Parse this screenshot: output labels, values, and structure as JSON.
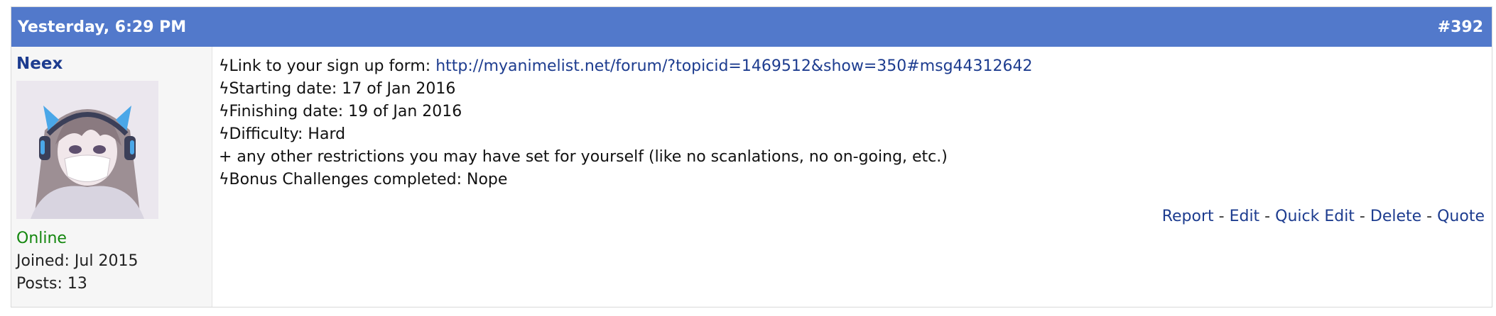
{
  "post": {
    "date": "Yesterday, 6:29 PM",
    "number": "#392"
  },
  "user": {
    "name": "Neex",
    "status": "Online",
    "joined": "Joined: Jul 2015",
    "posts": "Posts: 13"
  },
  "content": {
    "line1_label": "ϟLink to your sign up form: ",
    "line1_link": "http://myanimelist.net/forum/?topicid=1469512&show=350#msg44312642",
    "line2": "ϟStarting date: 17 of Jan 2016",
    "line3": "ϟFinishing date: 19 of Jan 2016",
    "line4": "ϟDifficulty: Hard",
    "line5": "+ any other restrictions you may have set for yourself (like no scanlations, no on-going, etc.)",
    "line6": "ϟBonus Challenges completed: Nope"
  },
  "actions": {
    "report": "Report",
    "edit": "Edit",
    "quick_edit": "Quick Edit",
    "delete": "Delete",
    "quote": "Quote",
    "separator": " - "
  },
  "colors": {
    "header_bg": "#5279cb",
    "link": "#1d3c8f",
    "online": "#14870f"
  }
}
